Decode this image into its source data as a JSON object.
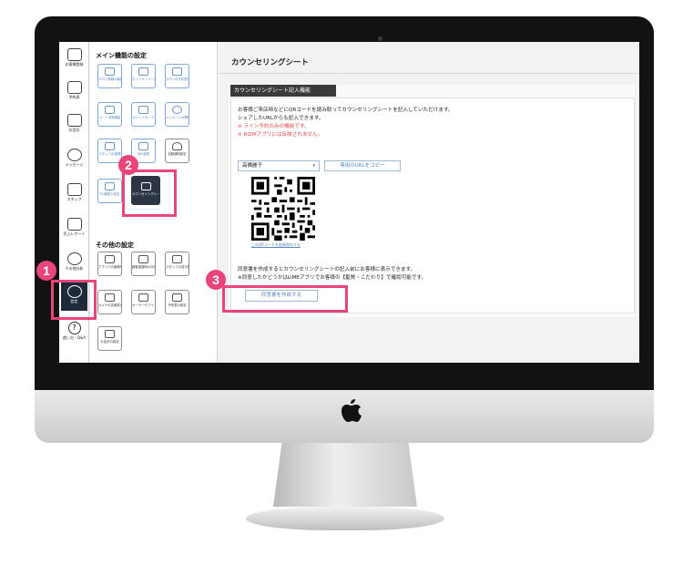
{
  "sidebar": {
    "items": [
      {
        "label": "お客様登録",
        "icon": "person-add-icon"
      },
      {
        "label": "予約表",
        "icon": "calendar-icon"
      },
      {
        "label": "お会計",
        "icon": "register-icon"
      },
      {
        "label": "メッセージ",
        "icon": "chat-icon"
      },
      {
        "label": "スタッフ",
        "icon": "staff-icon"
      },
      {
        "label": "売上レポート",
        "icon": "bar-chart-icon"
      },
      {
        "label": "その他分析",
        "icon": "pie-chart-icon"
      },
      {
        "label": "設定",
        "icon": "gear-icon"
      }
    ],
    "help_label": "使い方・Q&A"
  },
  "settings": {
    "main_title": "メイン機能の設定",
    "main_tiles": [
      {
        "label": "サロン情報の編集 新しい店舗の追加"
      },
      {
        "label": "ホットペッパー連携"
      },
      {
        "label": "サロンの予約受付設定"
      },
      {
        "label": "カード決済機能"
      },
      {
        "label": "ポイントカード"
      },
      {
        "label": "メッセージの開封集計"
      },
      {
        "label": "スタッフの管理"
      },
      {
        "label": "SNS連携"
      },
      {
        "label": "自動通知設定"
      },
      {
        "label": "EC機能の設定"
      },
      {
        "label": "カウンセリングシート"
      }
    ],
    "other_title": "その他の設定",
    "other_tiles": [
      {
        "label": "アプリでの画像情報の閲覧"
      },
      {
        "label": "顧客重複時の共有表の許可"
      },
      {
        "label": "スタッフの並び替え"
      },
      {
        "label": "カルテの定義表示の部分のみ表示"
      },
      {
        "label": "オーナーやフリーの予約情報の表示"
      },
      {
        "label": "予約表の設定"
      },
      {
        "label": "お会計の設定"
      }
    ]
  },
  "main": {
    "title": "カウンセリングシート",
    "section_label": "カウンセリングシート記入機能",
    "desc_line1": "お客様ご来店時などにQRコードを読み取ってカウンセリングシートを記入していただけます。",
    "desc_line2": "シェアしたURLからも記入できます。",
    "warn_line1": "※ ライン予約のみの機能です。",
    "warn_line2": "※ RIZMアプリには反映されません。",
    "selected_staff": "高橋麗子",
    "copy_url_label": "専用のURLをコピー",
    "qr_caption": "このQRコードを画像保存する",
    "note_line1": "同意書を作成するとカウンセリングシートの記入前にお客様に表示できます。",
    "note_line2": "※同意したかどうかはLiMEアプリでお客様の【髪質・こだわり】で確認可能です。",
    "create_consent_label": "同意書を作成する"
  },
  "annotations": {
    "step1": "1",
    "step2": "2",
    "step3": "3",
    "color": "#e8457a"
  }
}
